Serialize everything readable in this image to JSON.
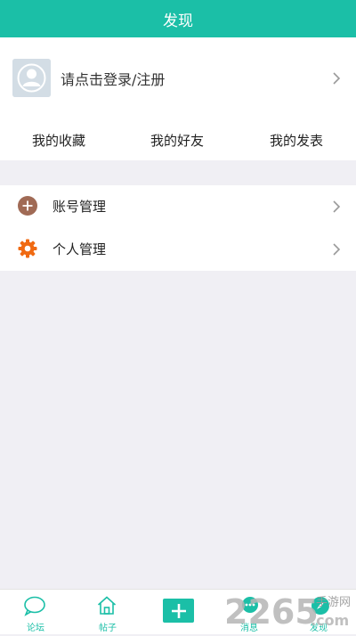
{
  "header": {
    "title": "发现"
  },
  "profile": {
    "login_text": "请点击登录/注册"
  },
  "quick_links": [
    "我的收藏",
    "我的好友",
    "我的发表"
  ],
  "settings": [
    {
      "label": "账号管理",
      "icon": "plus-circle-icon",
      "color": "#a06a55"
    },
    {
      "label": "个人管理",
      "icon": "gear-icon",
      "color": "#f06a12"
    }
  ],
  "tabbar": {
    "items": [
      {
        "label": "论坛",
        "icon": "chat-bubble-icon"
      },
      {
        "label": "帖子",
        "icon": "home-icon"
      },
      {
        "label": "",
        "icon": "plus-icon"
      },
      {
        "label": "消息",
        "icon": "message-icon"
      },
      {
        "label": "发现",
        "icon": "compass-icon"
      }
    ]
  },
  "watermark": {
    "brand": "2265",
    "domain": ".com",
    "tagline": "手游网"
  },
  "colors": {
    "accent": "#1bbfa7",
    "background": "#f0eff4"
  }
}
